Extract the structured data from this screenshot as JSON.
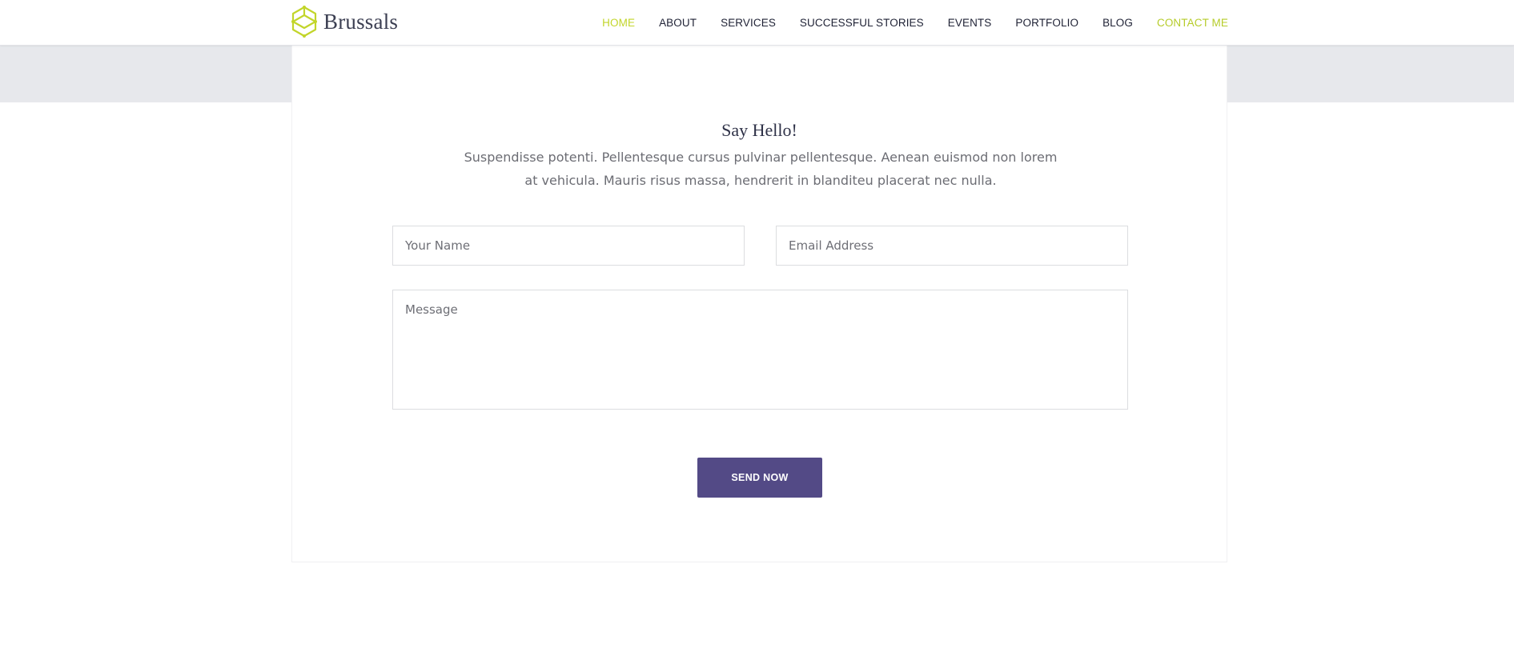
{
  "header": {
    "logo_text": "Brussals",
    "logo_icon": "hexagon-cube-icon",
    "nav": [
      {
        "label": "HOME"
      },
      {
        "label": "ABOUT"
      },
      {
        "label": "SERVICES"
      },
      {
        "label": "SUCCESSFUL STORIES"
      },
      {
        "label": "EVENTS"
      },
      {
        "label": "PORTFOLIO"
      },
      {
        "label": "BLOG"
      },
      {
        "label": "CONTACT ME"
      }
    ],
    "active_nav": "HOME"
  },
  "contact": {
    "title": "Say Hello!",
    "description_line1": "Suspendisse potenti. Pellentesque cursus pulvinar pellentesque. Aenean euismod non lorem",
    "description_line2": "at vehicula. Mauris risus massa, hendrerit in blanditeu placerat nec nulla.",
    "name_placeholder": "Your Name",
    "email_placeholder": "Email Address",
    "message_placeholder": "Message",
    "send_label": "SEND NOW"
  },
  "colors": {
    "accent": "#c2d52a",
    "button": "#534a86",
    "banner": "#e7e8ec",
    "text_dark": "#2e3147"
  }
}
